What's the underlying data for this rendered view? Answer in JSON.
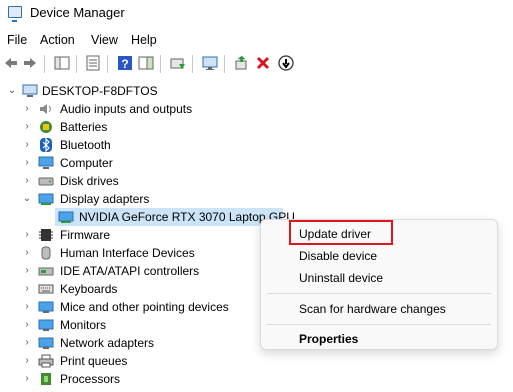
{
  "window": {
    "title": "Device Manager"
  },
  "menu": [
    "File",
    "Action",
    "View",
    "Help"
  ],
  "tree": {
    "root": "DESKTOP-F8DFTOS",
    "items": [
      {
        "label": "Audio inputs and outputs",
        "icon": "speaker-icon"
      },
      {
        "label": "Batteries",
        "icon": "battery-icon"
      },
      {
        "label": "Bluetooth",
        "icon": "bluetooth-icon"
      },
      {
        "label": "Computer",
        "icon": "computer-icon"
      },
      {
        "label": "Disk drives",
        "icon": "disk-drive-icon"
      },
      {
        "label": "Display adapters",
        "icon": "display-adapter-icon",
        "expanded": true
      },
      {
        "label": "NVIDIA GeForce RTX 3070 Laptop GPU",
        "icon": "gpu-icon",
        "child": true
      },
      {
        "label": "Firmware",
        "icon": "firmware-icon"
      },
      {
        "label": "Human Interface Devices",
        "icon": "hid-icon"
      },
      {
        "label": "IDE ATA/ATAPI controllers",
        "icon": "ide-controller-icon"
      },
      {
        "label": "Keyboards",
        "icon": "keyboard-icon"
      },
      {
        "label": "Mice and other pointing devices",
        "icon": "mouse-icon"
      },
      {
        "label": "Monitors",
        "icon": "monitor-icon"
      },
      {
        "label": "Network adapters",
        "icon": "network-adapter-icon"
      },
      {
        "label": "Print queues",
        "icon": "printer-icon"
      },
      {
        "label": "Processors",
        "icon": "processor-icon"
      }
    ]
  },
  "context_menu": {
    "update": "Update driver",
    "disable": "Disable device",
    "uninstall": "Uninstall device",
    "scan": "Scan for hardware changes",
    "properties": "Properties"
  },
  "colors": {
    "highlight_box": "#e0141e",
    "selection": "#cce4f7",
    "accent": "#2f6fb3"
  }
}
